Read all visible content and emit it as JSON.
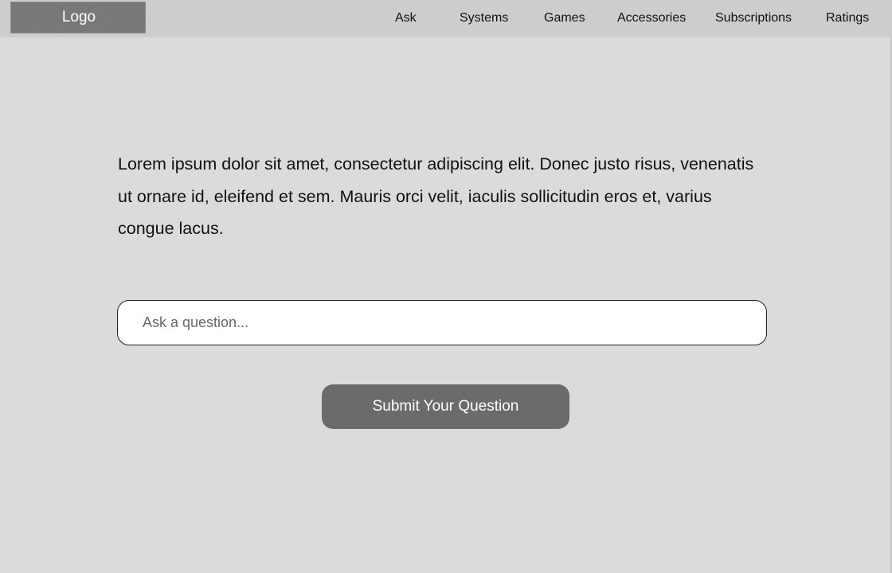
{
  "header": {
    "logo_label": "Logo",
    "nav": [
      {
        "label": "Ask"
      },
      {
        "label": "Systems"
      },
      {
        "label": "Games"
      },
      {
        "label": "Accessories"
      },
      {
        "label": "Subscriptions"
      },
      {
        "label": "Ratings"
      }
    ]
  },
  "main": {
    "intro_text": "Lorem ipsum dolor sit amet, consectetur adipiscing elit. Donec justo risus, venenatis ut ornare id, eleifend et sem. Mauris orci velit, iaculis sollicitudin eros et, varius congue lacus.",
    "question_input": {
      "value": "",
      "placeholder": "Ask a question..."
    },
    "submit_label": "Submit Your Question"
  },
  "colors": {
    "background": "#dbdbdb",
    "navbar": "#cdcdcd",
    "logo_box": "#7a7a7a",
    "button": "#6b6b6b",
    "input_background": "#ffffff"
  }
}
